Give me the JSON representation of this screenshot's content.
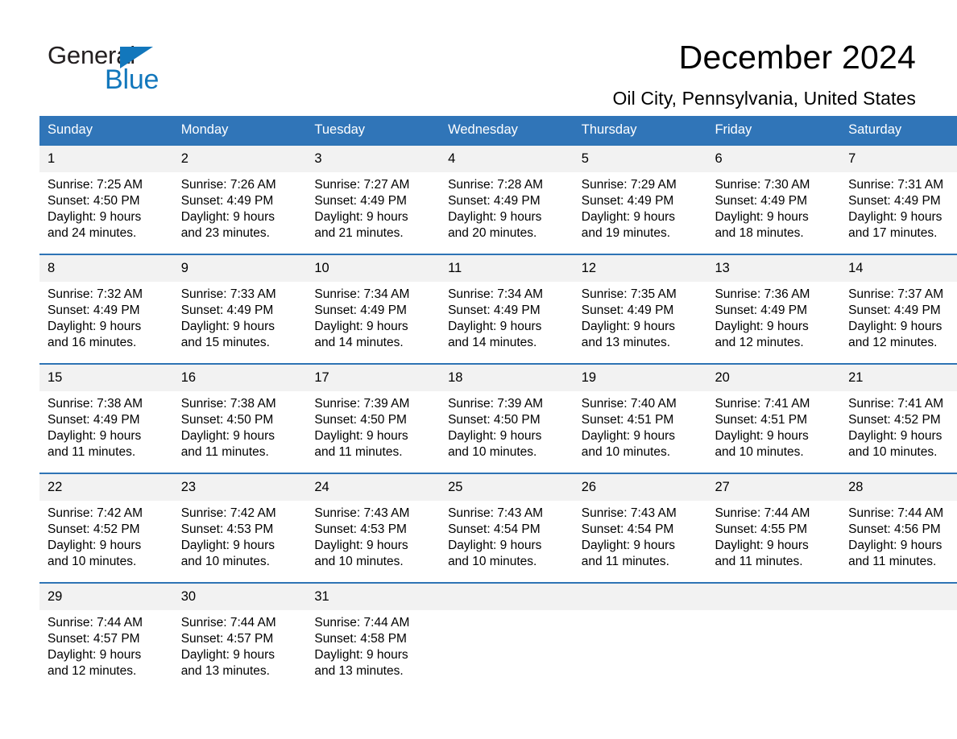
{
  "brand": {
    "name_part1": "General",
    "name_part2": "Blue",
    "triangle_icon": "triangle-icon",
    "accent_color": "#1277bc"
  },
  "header": {
    "title": "December 2024",
    "location": "Oil City, Pennsylvania, United States"
  },
  "colors": {
    "header_blue": "#3075b8",
    "row_divider_blue": "#2e74b5",
    "daynum_band": "#f2f2f2",
    "text": "#000000"
  },
  "calendar": {
    "weekday_headers": [
      "Sunday",
      "Monday",
      "Tuesday",
      "Wednesday",
      "Thursday",
      "Friday",
      "Saturday"
    ],
    "weeks": [
      [
        {
          "day": "1",
          "sunrise": "Sunrise: 7:25 AM",
          "sunset": "Sunset: 4:50 PM",
          "daylight_line1": "Daylight: 9 hours",
          "daylight_line2": "and 24 minutes."
        },
        {
          "day": "2",
          "sunrise": "Sunrise: 7:26 AM",
          "sunset": "Sunset: 4:49 PM",
          "daylight_line1": "Daylight: 9 hours",
          "daylight_line2": "and 23 minutes."
        },
        {
          "day": "3",
          "sunrise": "Sunrise: 7:27 AM",
          "sunset": "Sunset: 4:49 PM",
          "daylight_line1": "Daylight: 9 hours",
          "daylight_line2": "and 21 minutes."
        },
        {
          "day": "4",
          "sunrise": "Sunrise: 7:28 AM",
          "sunset": "Sunset: 4:49 PM",
          "daylight_line1": "Daylight: 9 hours",
          "daylight_line2": "and 20 minutes."
        },
        {
          "day": "5",
          "sunrise": "Sunrise: 7:29 AM",
          "sunset": "Sunset: 4:49 PM",
          "daylight_line1": "Daylight: 9 hours",
          "daylight_line2": "and 19 minutes."
        },
        {
          "day": "6",
          "sunrise": "Sunrise: 7:30 AM",
          "sunset": "Sunset: 4:49 PM",
          "daylight_line1": "Daylight: 9 hours",
          "daylight_line2": "and 18 minutes."
        },
        {
          "day": "7",
          "sunrise": "Sunrise: 7:31 AM",
          "sunset": "Sunset: 4:49 PM",
          "daylight_line1": "Daylight: 9 hours",
          "daylight_line2": "and 17 minutes."
        }
      ],
      [
        {
          "day": "8",
          "sunrise": "Sunrise: 7:32 AM",
          "sunset": "Sunset: 4:49 PM",
          "daylight_line1": "Daylight: 9 hours",
          "daylight_line2": "and 16 minutes."
        },
        {
          "day": "9",
          "sunrise": "Sunrise: 7:33 AM",
          "sunset": "Sunset: 4:49 PM",
          "daylight_line1": "Daylight: 9 hours",
          "daylight_line2": "and 15 minutes."
        },
        {
          "day": "10",
          "sunrise": "Sunrise: 7:34 AM",
          "sunset": "Sunset: 4:49 PM",
          "daylight_line1": "Daylight: 9 hours",
          "daylight_line2": "and 14 minutes."
        },
        {
          "day": "11",
          "sunrise": "Sunrise: 7:34 AM",
          "sunset": "Sunset: 4:49 PM",
          "daylight_line1": "Daylight: 9 hours",
          "daylight_line2": "and 14 minutes."
        },
        {
          "day": "12",
          "sunrise": "Sunrise: 7:35 AM",
          "sunset": "Sunset: 4:49 PM",
          "daylight_line1": "Daylight: 9 hours",
          "daylight_line2": "and 13 minutes."
        },
        {
          "day": "13",
          "sunrise": "Sunrise: 7:36 AM",
          "sunset": "Sunset: 4:49 PM",
          "daylight_line1": "Daylight: 9 hours",
          "daylight_line2": "and 12 minutes."
        },
        {
          "day": "14",
          "sunrise": "Sunrise: 7:37 AM",
          "sunset": "Sunset: 4:49 PM",
          "daylight_line1": "Daylight: 9 hours",
          "daylight_line2": "and 12 minutes."
        }
      ],
      [
        {
          "day": "15",
          "sunrise": "Sunrise: 7:38 AM",
          "sunset": "Sunset: 4:49 PM",
          "daylight_line1": "Daylight: 9 hours",
          "daylight_line2": "and 11 minutes."
        },
        {
          "day": "16",
          "sunrise": "Sunrise: 7:38 AM",
          "sunset": "Sunset: 4:50 PM",
          "daylight_line1": "Daylight: 9 hours",
          "daylight_line2": "and 11 minutes."
        },
        {
          "day": "17",
          "sunrise": "Sunrise: 7:39 AM",
          "sunset": "Sunset: 4:50 PM",
          "daylight_line1": "Daylight: 9 hours",
          "daylight_line2": "and 11 minutes."
        },
        {
          "day": "18",
          "sunrise": "Sunrise: 7:39 AM",
          "sunset": "Sunset: 4:50 PM",
          "daylight_line1": "Daylight: 9 hours",
          "daylight_line2": "and 10 minutes."
        },
        {
          "day": "19",
          "sunrise": "Sunrise: 7:40 AM",
          "sunset": "Sunset: 4:51 PM",
          "daylight_line1": "Daylight: 9 hours",
          "daylight_line2": "and 10 minutes."
        },
        {
          "day": "20",
          "sunrise": "Sunrise: 7:41 AM",
          "sunset": "Sunset: 4:51 PM",
          "daylight_line1": "Daylight: 9 hours",
          "daylight_line2": "and 10 minutes."
        },
        {
          "day": "21",
          "sunrise": "Sunrise: 7:41 AM",
          "sunset": "Sunset: 4:52 PM",
          "daylight_line1": "Daylight: 9 hours",
          "daylight_line2": "and 10 minutes."
        }
      ],
      [
        {
          "day": "22",
          "sunrise": "Sunrise: 7:42 AM",
          "sunset": "Sunset: 4:52 PM",
          "daylight_line1": "Daylight: 9 hours",
          "daylight_line2": "and 10 minutes."
        },
        {
          "day": "23",
          "sunrise": "Sunrise: 7:42 AM",
          "sunset": "Sunset: 4:53 PM",
          "daylight_line1": "Daylight: 9 hours",
          "daylight_line2": "and 10 minutes."
        },
        {
          "day": "24",
          "sunrise": "Sunrise: 7:43 AM",
          "sunset": "Sunset: 4:53 PM",
          "daylight_line1": "Daylight: 9 hours",
          "daylight_line2": "and 10 minutes."
        },
        {
          "day": "25",
          "sunrise": "Sunrise: 7:43 AM",
          "sunset": "Sunset: 4:54 PM",
          "daylight_line1": "Daylight: 9 hours",
          "daylight_line2": "and 10 minutes."
        },
        {
          "day": "26",
          "sunrise": "Sunrise: 7:43 AM",
          "sunset": "Sunset: 4:54 PM",
          "daylight_line1": "Daylight: 9 hours",
          "daylight_line2": "and 11 minutes."
        },
        {
          "day": "27",
          "sunrise": "Sunrise: 7:44 AM",
          "sunset": "Sunset: 4:55 PM",
          "daylight_line1": "Daylight: 9 hours",
          "daylight_line2": "and 11 minutes."
        },
        {
          "day": "28",
          "sunrise": "Sunrise: 7:44 AM",
          "sunset": "Sunset: 4:56 PM",
          "daylight_line1": "Daylight: 9 hours",
          "daylight_line2": "and 11 minutes."
        }
      ],
      [
        {
          "day": "29",
          "sunrise": "Sunrise: 7:44 AM",
          "sunset": "Sunset: 4:57 PM",
          "daylight_line1": "Daylight: 9 hours",
          "daylight_line2": "and 12 minutes."
        },
        {
          "day": "30",
          "sunrise": "Sunrise: 7:44 AM",
          "sunset": "Sunset: 4:57 PM",
          "daylight_line1": "Daylight: 9 hours",
          "daylight_line2": "and 13 minutes."
        },
        {
          "day": "31",
          "sunrise": "Sunrise: 7:44 AM",
          "sunset": "Sunset: 4:58 PM",
          "daylight_line1": "Daylight: 9 hours",
          "daylight_line2": "and 13 minutes."
        },
        {
          "day": "",
          "sunrise": "",
          "sunset": "",
          "daylight_line1": "",
          "daylight_line2": ""
        },
        {
          "day": "",
          "sunrise": "",
          "sunset": "",
          "daylight_line1": "",
          "daylight_line2": ""
        },
        {
          "day": "",
          "sunrise": "",
          "sunset": "",
          "daylight_line1": "",
          "daylight_line2": ""
        },
        {
          "day": "",
          "sunrise": "",
          "sunset": "",
          "daylight_line1": "",
          "daylight_line2": ""
        }
      ]
    ]
  }
}
